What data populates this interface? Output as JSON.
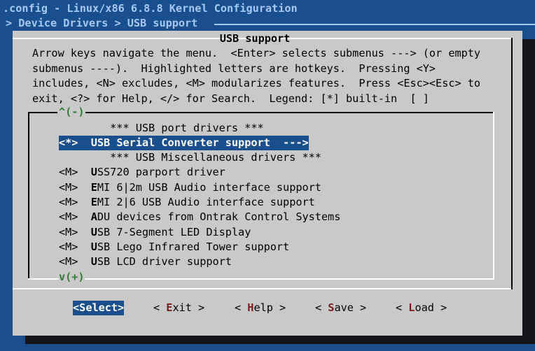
{
  "window": {
    "title": ".config - Linux/x86 6.8.8 Kernel Configuration",
    "breadcrumb": "> Device Drivers > USB support"
  },
  "dialog": {
    "title": "USB support",
    "help_lines": [
      "Arrow keys navigate the menu.  <Enter> selects submenus ---> (or empty",
      "submenus ----).  Highlighted letters are hotkeys.  Pressing <Y>",
      "includes, <N> excludes, <M> modularizes features.  Press <Esc><Esc> to",
      "exit, <?> for Help, </> for Search.  Legend: [*] built-in  [ ]"
    ],
    "scroll_up": "^(-)",
    "scroll_down": "v(+)"
  },
  "menu": {
    "items": [
      {
        "state": "",
        "hotkey": "",
        "rest": "*** USB port drivers ***"
      },
      {
        "state": "<*>",
        "hotkey": "U",
        "rest": "SB Serial Converter support  --->"
      },
      {
        "state": "",
        "hotkey": "",
        "rest": "*** USB Miscellaneous drivers ***"
      },
      {
        "state": "<M>",
        "hotkey": "U",
        "rest": "SS720 parport driver"
      },
      {
        "state": "<M>",
        "hotkey": "E",
        "rest": "MI 6|2m USB Audio interface support"
      },
      {
        "state": "<M>",
        "hotkey": "E",
        "rest": "MI 2|6 USB Audio interface support"
      },
      {
        "state": "<M>",
        "hotkey": "A",
        "rest": "DU devices from Ontrak Control Systems"
      },
      {
        "state": "<M>",
        "hotkey": "U",
        "rest": "SB 7-Segment LED Display"
      },
      {
        "state": "<M>",
        "hotkey": "U",
        "rest": "SB Lego Infrared Tower support"
      },
      {
        "state": "<M>",
        "hotkey": "U",
        "rest": "SB LCD driver support"
      }
    ]
  },
  "buttons": {
    "select": {
      "pre": "<",
      "hotkey": "S",
      "post": "elect>"
    },
    "exit": {
      "pre": "< ",
      "hotkey": "E",
      "post": "xit >"
    },
    "help": {
      "pre": "< ",
      "hotkey": "H",
      "post": "elp >"
    },
    "save": {
      "pre": "< ",
      "hotkey": "S",
      "post": "ave >"
    },
    "load": {
      "pre": "< ",
      "hotkey": "L",
      "post": "oad >"
    }
  },
  "colors": {
    "background": "#1a4f8e",
    "dialog": "#c9c9c9",
    "highlight": "#1a4f8e",
    "hotkey": "#7a1a1a",
    "scroll_indicator": "#2e7d32"
  }
}
